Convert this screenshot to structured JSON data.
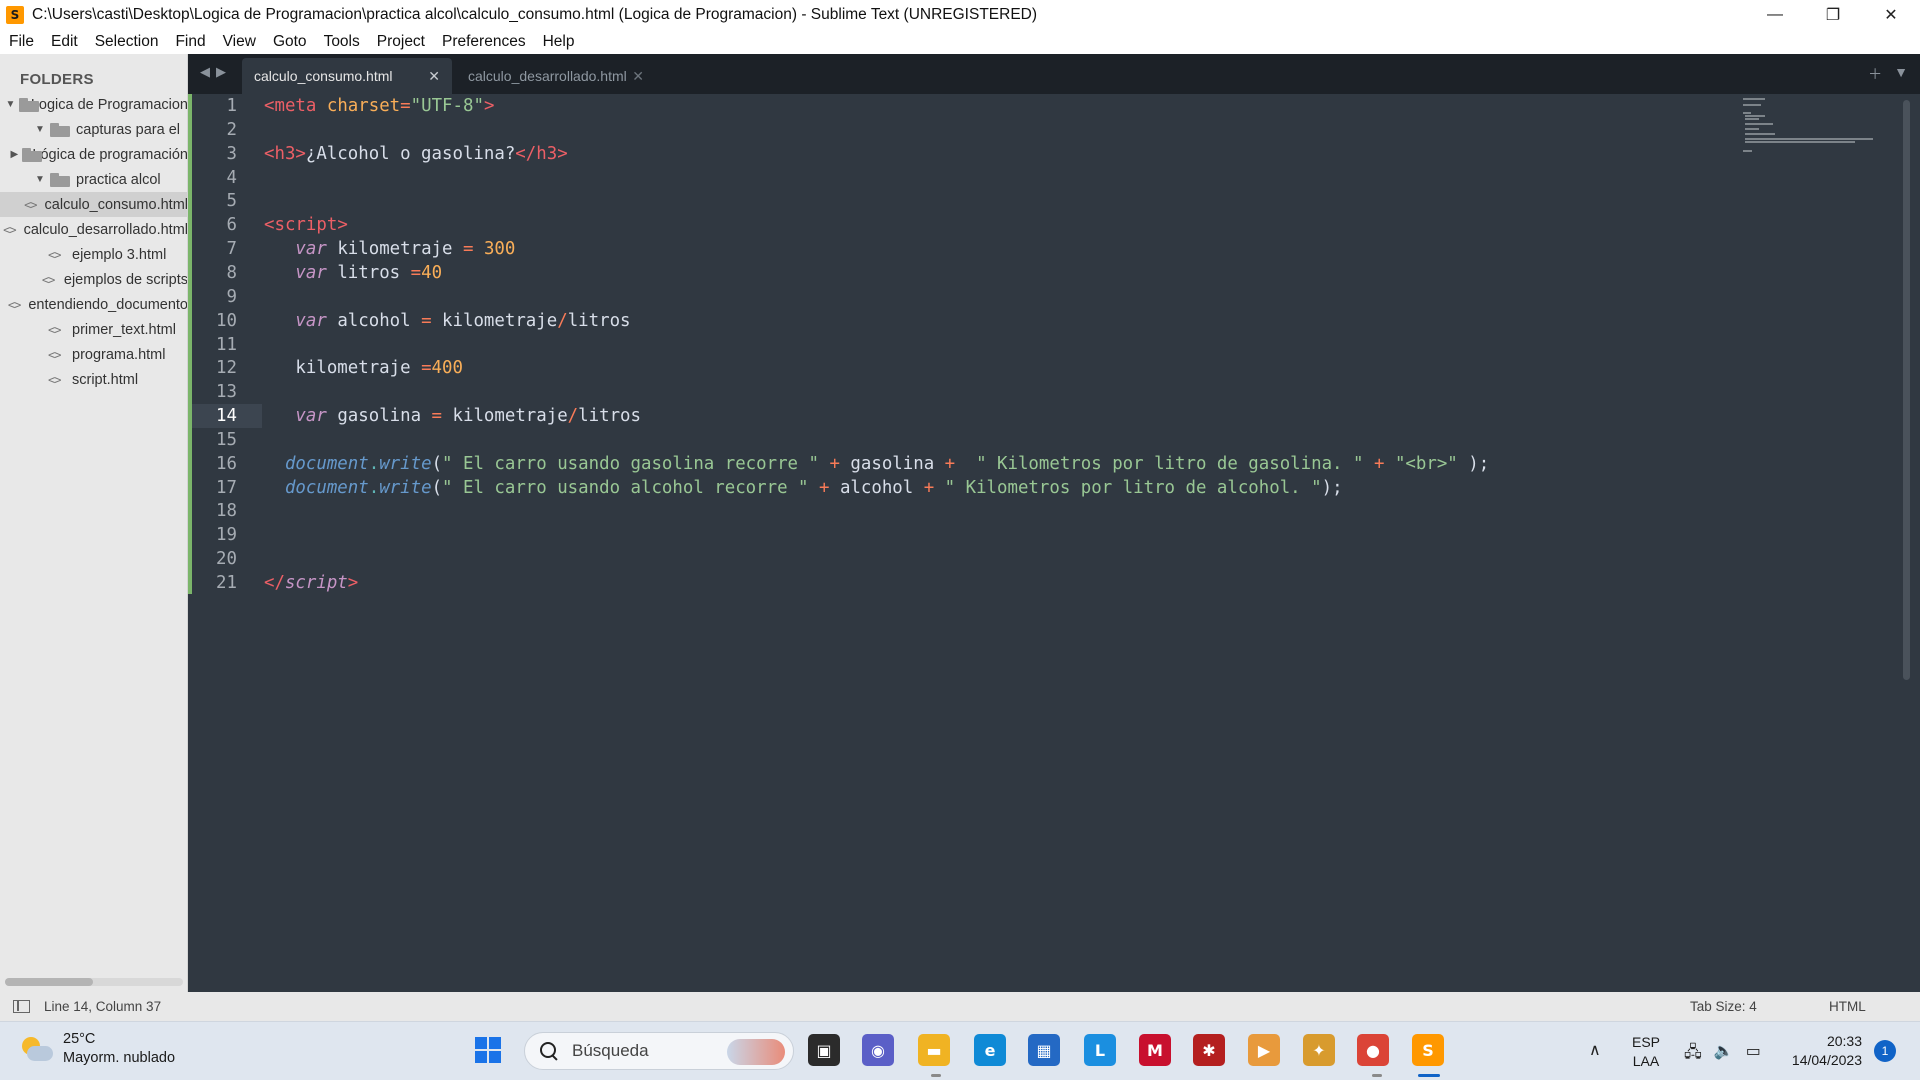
{
  "window": {
    "title": "C:\\Users\\casti\\Desktop\\Logica de Programacion\\practica alcol\\calculo_consumo.html (Logica de Programacion) - Sublime Text (UNREGISTERED)",
    "controls": {
      "minimize": "—",
      "maximize": "❐",
      "close": "✕"
    }
  },
  "menu": [
    "File",
    "Edit",
    "Selection",
    "Find",
    "View",
    "Goto",
    "Tools",
    "Project",
    "Preferences",
    "Help"
  ],
  "sidebar": {
    "header": "FOLDERS",
    "items": [
      {
        "label": "Logica de Programacion",
        "type": "folder",
        "expanded": true,
        "depth": 0
      },
      {
        "label": "capturas para el",
        "type": "folder",
        "expanded": true,
        "depth": 1
      },
      {
        "label": "Lógica de programación",
        "type": "folder",
        "expanded": false,
        "depth": 2
      },
      {
        "label": "practica alcol",
        "type": "folder",
        "expanded": true,
        "depth": 1
      },
      {
        "label": "calculo_consumo.html",
        "type": "file",
        "depth": 2,
        "selected": true
      },
      {
        "label": "calculo_desarrollado.html",
        "type": "file",
        "depth": 2
      },
      {
        "label": "ejemplo 3.html",
        "type": "file",
        "depth": 1
      },
      {
        "label": "ejemplos de scripts",
        "type": "file",
        "depth": 1
      },
      {
        "label": "entendiendo_documento",
        "type": "file",
        "depth": 1
      },
      {
        "label": "primer_text.html",
        "type": "file",
        "depth": 1
      },
      {
        "label": "programa.html",
        "type": "file",
        "depth": 1
      },
      {
        "label": "script.html",
        "type": "file",
        "depth": 1
      }
    ]
  },
  "tabs": [
    {
      "label": "calculo_consumo.html",
      "active": true
    },
    {
      "label": "calculo_desarrollado.html",
      "active": false
    }
  ],
  "editor": {
    "current_line": 14,
    "lines": [
      [
        [
          "tg",
          "<"
        ],
        [
          "tg",
          "meta"
        ],
        [
          "id",
          " "
        ],
        [
          "at",
          "charset"
        ],
        [
          "op",
          "="
        ],
        [
          "st",
          "\"UTF-8\""
        ],
        [
          "tg",
          ">"
        ]
      ],
      [],
      [
        [
          "tg",
          "<h3>"
        ],
        [
          "id",
          "¿Alcohol o gasolina?"
        ],
        [
          "tg",
          "</"
        ],
        [
          "tg",
          "h3>"
        ]
      ],
      [],
      [],
      [
        [
          "tg",
          "<"
        ],
        [
          "tg",
          "script"
        ],
        [
          "tg",
          ">"
        ]
      ],
      [
        [
          "id",
          "   "
        ],
        [
          "kw",
          "var"
        ],
        [
          "id",
          " kilometraje "
        ],
        [
          "op",
          "="
        ],
        [
          "id",
          " "
        ],
        [
          "nu",
          "300"
        ]
      ],
      [
        [
          "id",
          "   "
        ],
        [
          "kw",
          "var"
        ],
        [
          "id",
          " litros "
        ],
        [
          "op",
          "="
        ],
        [
          "nu",
          "40"
        ]
      ],
      [],
      [
        [
          "id",
          "   "
        ],
        [
          "kw",
          "var"
        ],
        [
          "id",
          " alcohol "
        ],
        [
          "op",
          "="
        ],
        [
          "id",
          " kilometraje"
        ],
        [
          "op",
          "/"
        ],
        [
          "id",
          "litros"
        ]
      ],
      [],
      [
        [
          "id",
          "   kilometraje "
        ],
        [
          "op",
          "="
        ],
        [
          "nu",
          "400"
        ]
      ],
      [],
      [
        [
          "id",
          "   "
        ],
        [
          "kw",
          "var"
        ],
        [
          "id",
          " gasolina "
        ],
        [
          "op",
          "="
        ],
        [
          "id",
          " kilometraje"
        ],
        [
          "op",
          "/"
        ],
        [
          "id",
          "litros"
        ]
      ],
      [],
      [
        [
          "id",
          "  "
        ],
        [
          "fn",
          "document"
        ],
        [
          "pu",
          "."
        ],
        [
          "fn",
          "write"
        ],
        [
          "id",
          "("
        ],
        [
          "st",
          "\" El carro usando gasolina recorre \""
        ],
        [
          "id",
          " "
        ],
        [
          "op",
          "+"
        ],
        [
          "id",
          " gasolina "
        ],
        [
          "op",
          "+"
        ],
        [
          "id",
          "  "
        ],
        [
          "st",
          "\" Kilometros por litro de gasolina. \""
        ],
        [
          "id",
          " "
        ],
        [
          "op",
          "+"
        ],
        [
          "id",
          " "
        ],
        [
          "st",
          "\"<br>\""
        ],
        [
          "id",
          " );"
        ]
      ],
      [
        [
          "id",
          "  "
        ],
        [
          "fn",
          "document"
        ],
        [
          "pu",
          "."
        ],
        [
          "fn",
          "write"
        ],
        [
          "id",
          "("
        ],
        [
          "st",
          "\" El carro usando alcohol recorre \""
        ],
        [
          "id",
          " "
        ],
        [
          "op",
          "+"
        ],
        [
          "id",
          " alcohol "
        ],
        [
          "op",
          "+"
        ],
        [
          "id",
          " "
        ],
        [
          "st",
          "\" Kilometros por litro de alcohol. \""
        ],
        [
          "id",
          ");"
        ]
      ],
      [],
      [],
      [],
      [
        [
          "tg",
          "</"
        ],
        [
          "kw",
          "script"
        ],
        [
          "tg",
          ">"
        ]
      ]
    ]
  },
  "status": {
    "cursor": "Line 14, Column 37",
    "tab_size": "Tab Size: 4",
    "syntax": "HTML"
  },
  "taskbar": {
    "weather_temp": "25°C",
    "weather_desc": "Mayorm. nublado",
    "search_placeholder": "Búsqueda",
    "apps": [
      {
        "name": "windows-start-icon",
        "glyph": "",
        "color": "#1a73e8"
      },
      {
        "name": "task-view-icon",
        "glyph": "▣",
        "color": "#2b2b2b"
      },
      {
        "name": "chat-icon",
        "glyph": "◉",
        "color": "#5b5fc7"
      },
      {
        "name": "file-explorer-icon",
        "glyph": "▬",
        "color": "#f0b323"
      },
      {
        "name": "edge-icon",
        "glyph": "e",
        "color": "#0f8ad6"
      },
      {
        "name": "store-icon",
        "glyph": "▦",
        "color": "#2469c4"
      },
      {
        "name": "l-app-icon",
        "glyph": "L",
        "color": "#1b8fe0"
      },
      {
        "name": "mcafee-icon",
        "glyph": "M",
        "color": "#c8102e"
      },
      {
        "name": "red-app-icon",
        "glyph": "✱",
        "color": "#b41f1f"
      },
      {
        "name": "media-player-icon",
        "glyph": "▶",
        "color": "#e89a3c"
      },
      {
        "name": "game-icon",
        "glyph": "✦",
        "color": "#d89b2e"
      },
      {
        "name": "chrome-icon",
        "glyph": "●",
        "color": "#db4437"
      },
      {
        "name": "sublime-text-icon",
        "glyph": "S",
        "color": "#ff9800"
      }
    ],
    "lang_top": "ESP",
    "lang_bottom": "LAA",
    "time": "20:33",
    "date": "14/04/2023",
    "notifications": "1"
  }
}
